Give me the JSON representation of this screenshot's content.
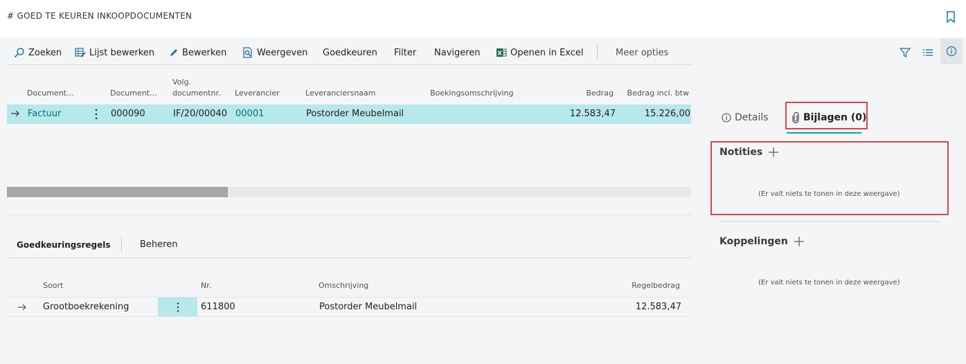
{
  "header": {
    "title": "# GOED TE KEUREN INKOOPDOCUMENTEN"
  },
  "actions": {
    "search": "Zoeken",
    "edit_list": "Lijst bewerken",
    "edit": "Bewerken",
    "view": "Weergeven",
    "approve": "Goedkeuren",
    "filter": "Filter",
    "navigate": "Navigeren",
    "open_excel": "Openen in Excel",
    "more": "Meer opties"
  },
  "table": {
    "columns": {
      "document_type": "Document…",
      "document_no": "Document…",
      "seq_line1": "Volg.",
      "seq_line2": "documentnr.",
      "vendor": "Leverancier",
      "vendor_name": "Leveranciersnaam",
      "posting_description": "Boekingsomschrijving",
      "amount": "Bedrag",
      "amount_incl_vat": "Bedrag incl. btw"
    },
    "rows": [
      {
        "document_type": "Factuur",
        "document_no": "000090",
        "seq_no": "IF/20/00040",
        "vendor": "00001",
        "vendor_name": "Postorder Meubelmail",
        "posting_description": "",
        "amount": "12.583,47",
        "amount_incl_vat": "15.226,00"
      }
    ]
  },
  "subpage": {
    "tabs": {
      "lines": "Goedkeuringsregels",
      "manage": "Beheren"
    },
    "columns": {
      "type": "Soort",
      "no": "Nr.",
      "description": "Omschrijving",
      "line_amount": "Regelbedrag"
    },
    "rows": [
      {
        "type": "Grootboekrekening",
        "no": "611800",
        "description": "Postorder Meubelmail",
        "line_amount": "12.583,47"
      }
    ]
  },
  "factbox": {
    "tabs": {
      "details": "Details",
      "attachments": "Bijlagen (0)"
    },
    "notes": {
      "title": "Notities",
      "empty": "(Er valt niets te tonen in deze weergave)"
    },
    "links": {
      "title": "Koppelingen",
      "empty": "(Er valt niets te tonen in deze weergave)"
    }
  },
  "colors": {
    "accent": "#00a7b5",
    "selected_row": "#b7e8ea",
    "link": "#00727a",
    "highlight_box": "#d9434a",
    "excel_green": "#1e7145"
  },
  "icons": [
    "search-icon",
    "edit-list-icon",
    "pencil-icon",
    "view-icon",
    "excel-icon",
    "filter-icon",
    "list-icon",
    "info-icon",
    "bookmark-icon",
    "arrow-right-icon",
    "paperclip-icon",
    "more-vertical-icon",
    "plus-icon"
  ]
}
